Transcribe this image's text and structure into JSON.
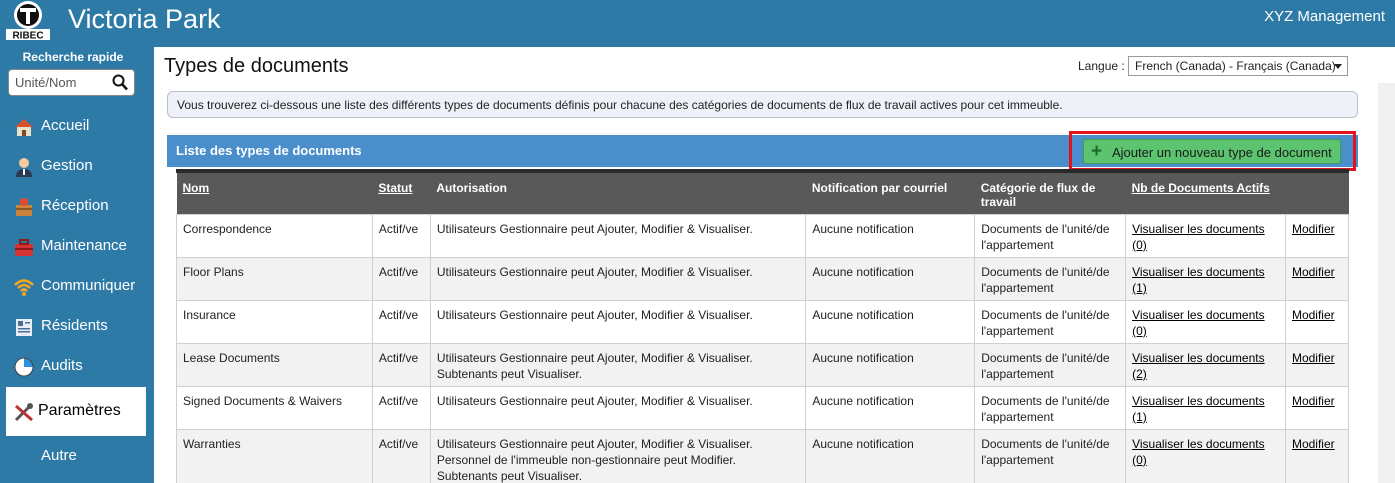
{
  "header": {
    "app_title": "Victoria Park",
    "company": "XYZ Management",
    "logo_text": "RIBEC"
  },
  "sidebar": {
    "quick_search_label": "Recherche rapide",
    "search_placeholder": "Unité/Nom",
    "items": [
      {
        "label": "Accueil",
        "icon": "home-icon"
      },
      {
        "label": "Gestion",
        "icon": "manager-icon"
      },
      {
        "label": "Réception",
        "icon": "reception-icon"
      },
      {
        "label": "Maintenance",
        "icon": "toolbox-icon"
      },
      {
        "label": "Communiquer",
        "icon": "wifi-icon"
      },
      {
        "label": "Résidents",
        "icon": "residents-icon"
      },
      {
        "label": "Audits",
        "icon": "pie-chart-icon"
      },
      {
        "label": "Paramètres",
        "icon": "tools-icon",
        "active": true
      },
      {
        "label": "Autre",
        "icon": ""
      }
    ]
  },
  "page": {
    "title": "Types de documents",
    "language_label": "Langue :",
    "language_value": "French (Canada) - Français (Canada)",
    "info_text": "Vous trouverez ci-dessous une liste des différents types de documents définis pour chacune des catégories de documents de flux de travail actives pour cet immeuble.",
    "list_title": "Liste des types de documents",
    "add_button_label": "Ajouter un nouveau type de document"
  },
  "table": {
    "headers": {
      "nom": "Nom",
      "statut": "Statut",
      "autorisation": "Autorisation",
      "notification": "Notification par courriel",
      "categorie": "Catégorie de flux de travail",
      "nb_docs": "Nb de Documents Actifs",
      "modifier": ""
    },
    "rows": [
      {
        "nom": "Correspondence",
        "statut": "Actif/ve",
        "autorisation": [
          "Utilisateurs Gestionnaire peut Ajouter, Modifier & Visualiser."
        ],
        "notification": "Aucune notification",
        "categorie": "Documents de l'unité/de l'appartement",
        "view_label": "Visualiser les documents",
        "count": "(0)",
        "modify": "Modifier"
      },
      {
        "nom": "Floor Plans",
        "statut": "Actif/ve",
        "autorisation": [
          "Utilisateurs Gestionnaire peut Ajouter, Modifier & Visualiser."
        ],
        "notification": "Aucune notification",
        "categorie": "Documents de l'unité/de l'appartement",
        "view_label": "Visualiser les documents",
        "count": "(1)",
        "modify": "Modifier"
      },
      {
        "nom": "Insurance",
        "statut": "Actif/ve",
        "autorisation": [
          "Utilisateurs Gestionnaire peut Ajouter, Modifier & Visualiser."
        ],
        "notification": "Aucune notification",
        "categorie": "Documents de l'unité/de l'appartement",
        "view_label": "Visualiser les documents",
        "count": "(0)",
        "modify": "Modifier"
      },
      {
        "nom": "Lease Documents",
        "statut": "Actif/ve",
        "autorisation": [
          "Utilisateurs Gestionnaire peut Ajouter, Modifier & Visualiser.",
          "Subtenants peut Visualiser."
        ],
        "notification": "Aucune notification",
        "categorie": "Documents de l'unité/de l'appartement",
        "view_label": "Visualiser les documents",
        "count": "(2)",
        "modify": "Modifier"
      },
      {
        "nom": "Signed Documents & Waivers",
        "statut": "Actif/ve",
        "autorisation": [
          "Utilisateurs Gestionnaire peut Ajouter, Modifier & Visualiser."
        ],
        "notification": "Aucune notification",
        "categorie": "Documents de l'unité/de l'appartement",
        "view_label": "Visualiser les documents",
        "count": "(1)",
        "modify": "Modifier"
      },
      {
        "nom": "Warranties",
        "statut": "Actif/ve",
        "autorisation": [
          "Utilisateurs Gestionnaire peut Ajouter, Modifier & Visualiser.",
          "Personnel de l'immeuble non-gestionnaire peut Modifier.",
          "Subtenants peut Visualiser."
        ],
        "notification": "Aucune notification",
        "categorie": "Documents de l'unité/de l'appartement",
        "view_label": "Visualiser les documents",
        "count": "(0)",
        "modify": "Modifier"
      }
    ]
  }
}
